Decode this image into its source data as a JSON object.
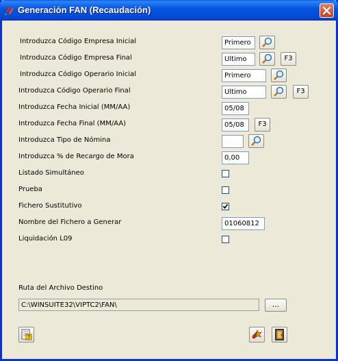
{
  "window": {
    "title": "Generación FAN (Recaudación)",
    "close_icon": "close-icon"
  },
  "colors": {
    "title_bar": "#0054e3",
    "window_bg": "#ece9d8",
    "close_button": "#e05b36",
    "field_border": "#7f9db9"
  },
  "form": {
    "empresa_inicial": {
      "label": "Introduzca Código Empresa Inicial",
      "value": "Primero"
    },
    "empresa_final": {
      "label": "Introduzca Código Empresa Final",
      "value": "Ultimo",
      "f3": "F3"
    },
    "operario_inicial": {
      "label": "Introduzca Código Operario Inicial",
      "value": "Primero"
    },
    "operario_final": {
      "label": "Introduzca Código Operario Final",
      "value": "Ultimo",
      "f3": "F3"
    },
    "fecha_inicial": {
      "label": "Introduzca Fecha Inicial (MM/AA)",
      "value": "05/08"
    },
    "fecha_final": {
      "label": "Introduzca Fecha Final (MM/AA)",
      "value": "05/08",
      "f3": "F3"
    },
    "tipo_nomina": {
      "label": "Introduzca Tipo de Nómina",
      "value": ""
    },
    "recargo_mora": {
      "label": "Introduzca % de Recargo de Mora",
      "value": "0,00"
    },
    "listado_simultaneo": {
      "label": "Listado Simultáneo",
      "checked": false
    },
    "prueba": {
      "label": "Prueba",
      "checked": false
    },
    "fichero_sustitutivo": {
      "label": "Fichero Sustitutivo",
      "checked": true
    },
    "nombre_fichero": {
      "label": "Nombre del Fichero a Generar",
      "value": "01060812"
    },
    "liquidacion_l09": {
      "label": "Liquidación L09",
      "checked": false
    },
    "ruta_destino": {
      "label": "Ruta del Archivo Destino",
      "value": "C:\\WINSUITE32\\VIPTC2\\FAN\\",
      "browse": "..."
    }
  },
  "icons": {
    "search": "magnifier-icon",
    "help": "help-document-icon",
    "execute": "execute-icon",
    "exit": "exit-door-icon"
  }
}
